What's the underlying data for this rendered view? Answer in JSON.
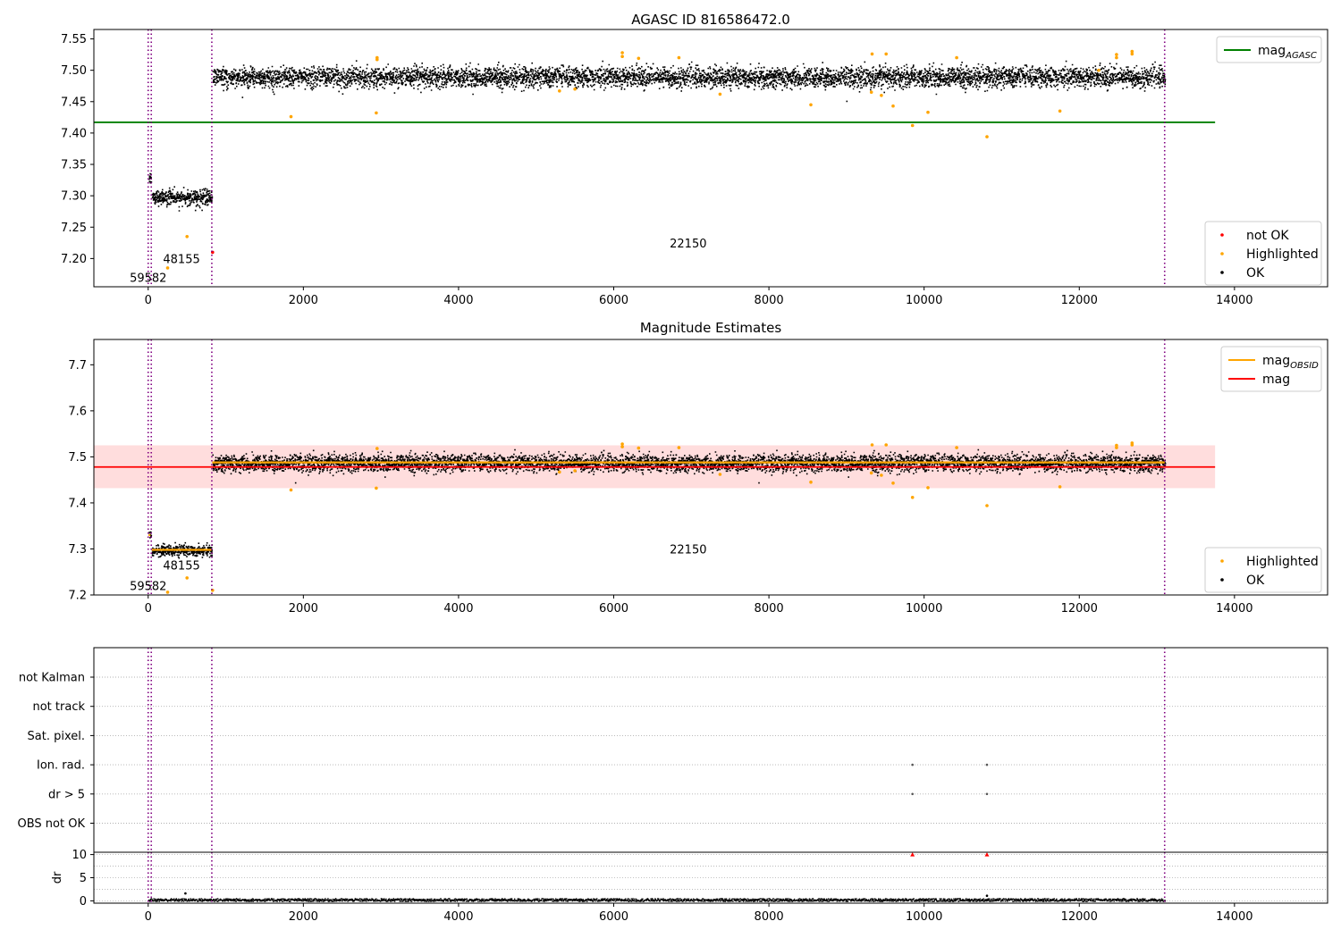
{
  "chart_data": [
    {
      "id": "agasc",
      "type": "scatter",
      "title": "AGASC ID 816586472.0",
      "xlim": [
        -700,
        15200
      ],
      "ylim": [
        7.155,
        7.565
      ],
      "xticks": [
        0,
        2000,
        4000,
        6000,
        8000,
        10000,
        12000,
        14000
      ],
      "yticks": [
        7.2,
        7.25,
        7.3,
        7.35,
        7.4,
        7.45,
        7.5,
        7.55
      ],
      "ytick_format": 2,
      "vlines": [
        0,
        40,
        820,
        13100
      ],
      "hline": {
        "name": "mag",
        "subscript": "AGASC",
        "y": 7.417,
        "x": [
          -700,
          13750
        ],
        "color": "#008000"
      },
      "bands": [
        {
          "x": [
            5,
            30
          ],
          "y": 7.33,
          "spread": 0.006
        },
        {
          "x": [
            45,
            815
          ],
          "y": 7.298,
          "spread": 0.006
        },
        {
          "x": [
            825,
            13100
          ],
          "y": 7.49,
          "spread": 0.008
        }
      ],
      "highlighted": [
        [
          250,
          7.185
        ],
        [
          500,
          7.235
        ],
        [
          1840,
          7.426
        ],
        [
          2940,
          7.432
        ],
        [
          2950,
          7.517
        ],
        [
          2950,
          7.52
        ],
        [
          5300,
          7.467
        ],
        [
          5500,
          7.47
        ],
        [
          6110,
          7.522
        ],
        [
          6110,
          7.528
        ],
        [
          6320,
          7.519
        ],
        [
          6840,
          7.52
        ],
        [
          7370,
          7.462
        ],
        [
          8540,
          7.445
        ],
        [
          9320,
          7.465
        ],
        [
          9330,
          7.526
        ],
        [
          9450,
          7.46
        ],
        [
          9510,
          7.526
        ],
        [
          9600,
          7.443
        ],
        [
          9850,
          7.412
        ],
        [
          10050,
          7.433
        ],
        [
          10420,
          7.52
        ],
        [
          10810,
          7.394
        ],
        [
          11750,
          7.435
        ],
        [
          12480,
          7.52
        ],
        [
          12480,
          7.525
        ],
        [
          12680,
          7.526
        ],
        [
          12680,
          7.53
        ],
        [
          12250,
          7.5
        ]
      ],
      "not_ok": [
        [
          830,
          7.21
        ]
      ],
      "obs_labels": [
        {
          "text": "59582",
          "x": 0,
          "y": 7.17
        },
        {
          "text": "48155",
          "x": 430,
          "y": 7.2
        },
        {
          "text": "22150",
          "x": 6960,
          "y": 7.225
        }
      ],
      "legend_top": [
        {
          "label": "mag",
          "subscript": "AGASC",
          "color": "#008000",
          "kind": "line"
        }
      ],
      "legend_bottom": [
        {
          "label": "not OK",
          "color": "#ff0000",
          "kind": "dot"
        },
        {
          "label": "Highlighted",
          "color": "#ffa500",
          "kind": "dot"
        },
        {
          "label": "OK",
          "color": "#000000",
          "kind": "dot"
        }
      ]
    },
    {
      "id": "estimates",
      "type": "scatter",
      "title": "Magnitude Estimates",
      "xlim": [
        -700,
        15200
      ],
      "ylim": [
        7.2,
        7.755
      ],
      "xticks": [
        0,
        2000,
        4000,
        6000,
        8000,
        10000,
        12000,
        14000
      ],
      "yticks": [
        7.2,
        7.3,
        7.4,
        7.5,
        7.6,
        7.7
      ],
      "ytick_format": 1,
      "vlines": [
        0,
        40,
        820,
        13100
      ],
      "hline": {
        "name": "mag",
        "y": 7.478,
        "x": [
          -700,
          13750
        ],
        "color": "#ff0000"
      },
      "band_fill": {
        "y": [
          7.432,
          7.525
        ],
        "x": [
          -700,
          13750
        ],
        "color": "#ffdddd"
      },
      "obsid_segments": [
        {
          "x": [
            5,
            30
          ],
          "y": 7.33
        },
        {
          "x": [
            45,
            815
          ],
          "y": 7.298
        },
        {
          "x": [
            825,
            13100
          ],
          "y": 7.488
        }
      ],
      "bands": [
        {
          "x": [
            5,
            30
          ],
          "y": 7.33,
          "spread": 0.006
        },
        {
          "x": [
            45,
            815
          ],
          "y": 7.298,
          "spread": 0.006
        },
        {
          "x": [
            825,
            13100
          ],
          "y": 7.488,
          "spread": 0.009
        }
      ],
      "highlighted": [
        [
          250,
          7.206
        ],
        [
          500,
          7.237
        ],
        [
          830,
          7.21
        ],
        [
          1840,
          7.428
        ],
        [
          2940,
          7.432
        ],
        [
          2950,
          7.518
        ],
        [
          5300,
          7.467
        ],
        [
          5500,
          7.47
        ],
        [
          6110,
          7.522
        ],
        [
          6110,
          7.528
        ],
        [
          6320,
          7.519
        ],
        [
          6840,
          7.52
        ],
        [
          7370,
          7.462
        ],
        [
          8540,
          7.445
        ],
        [
          9320,
          7.465
        ],
        [
          9330,
          7.526
        ],
        [
          9450,
          7.46
        ],
        [
          9510,
          7.526
        ],
        [
          9600,
          7.443
        ],
        [
          9850,
          7.412
        ],
        [
          10050,
          7.433
        ],
        [
          10420,
          7.52
        ],
        [
          10810,
          7.394
        ],
        [
          11750,
          7.435
        ],
        [
          12480,
          7.52
        ],
        [
          12480,
          7.525
        ],
        [
          12680,
          7.526
        ],
        [
          12680,
          7.53
        ]
      ],
      "obs_labels": [
        {
          "text": "59582",
          "x": 0,
          "y": 7.22
        },
        {
          "text": "48155",
          "x": 430,
          "y": 7.265
        },
        {
          "text": "22150",
          "x": 6960,
          "y": 7.3
        }
      ],
      "legend_top": [
        {
          "label": "mag",
          "subscript": "OBSID",
          "color": "#ffa500",
          "kind": "line"
        },
        {
          "label": "mag",
          "color": "#ff0000",
          "kind": "line"
        }
      ],
      "legend_bottom": [
        {
          "label": "Highlighted",
          "color": "#ffa500",
          "kind": "dot"
        },
        {
          "label": "OK",
          "color": "#000000",
          "kind": "dot"
        }
      ]
    },
    {
      "id": "flags",
      "type": "scatter",
      "xlim": [
        -700,
        15200
      ],
      "rows": [
        "not Kalman",
        "not track",
        "Sat. pixel.",
        "Ion. rad.",
        "dr > 5",
        "OBS not OK"
      ],
      "flag_points": [
        {
          "row": "Ion. rad.",
          "x": [
            9850,
            10810
          ]
        },
        {
          "row": "dr > 5",
          "x": [
            9850,
            10810
          ]
        }
      ],
      "vlines": [
        0,
        40,
        820,
        13100
      ]
    },
    {
      "id": "dr",
      "type": "scatter",
      "ylabel": "dr",
      "xlim": [
        -700,
        15200
      ],
      "ylim": [
        -0.5,
        10.5
      ],
      "xticks": [
        0,
        2000,
        4000,
        6000,
        8000,
        10000,
        12000,
        14000
      ],
      "yticks": [
        0,
        5,
        10
      ],
      "capped": [
        [
          9850,
          10
        ],
        [
          10810,
          10
        ]
      ],
      "dr_band": {
        "x": [
          0,
          13100
        ],
        "max": 0.6
      },
      "dr_outliers": [
        [
          480,
          1.6
        ],
        [
          10810,
          1.1
        ]
      ],
      "vlines": [
        0,
        40,
        820,
        13100
      ]
    }
  ],
  "colors": {
    "vline": "#800080",
    "ok": "#000000",
    "highlighted": "#ffa500",
    "not_ok": "#ff0000"
  }
}
